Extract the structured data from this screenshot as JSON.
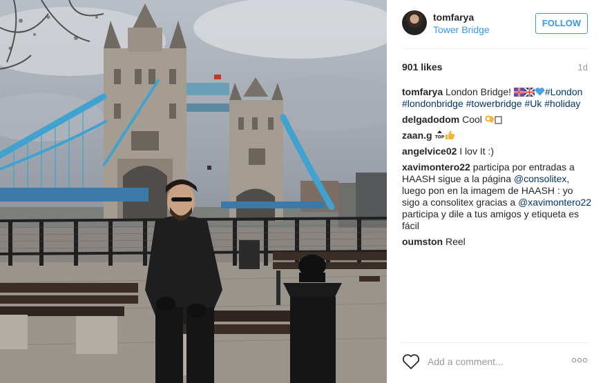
{
  "post": {
    "username": "tomfarya",
    "location": "Tower Bridge",
    "follow_label": "FOLLOW",
    "likes": "901 likes",
    "age": "1d"
  },
  "comments": [
    {
      "author": "tomfarya",
      "text": "London Bridge!",
      "tags": [
        "#London",
        "#londonbridge",
        "#towerbridge",
        "#Uk",
        "#holiday"
      ]
    },
    {
      "author": "delgadodom",
      "text": "Cool"
    },
    {
      "author": "zaan.g",
      "text": ""
    },
    {
      "author": "angelvice02",
      "text": "I lov It :)"
    },
    {
      "author": "xavimontero22",
      "text_1": "participa por entradas a HAASH sigue a la página",
      "mention_1": "@consolitex",
      "text_2": ", luego pon en la imagem de HAASH : yo sigo a consolitex gracias a",
      "mention_2": "@xavimontero22",
      "text_3": "participa y dile a tus amigos y etiqueta es fácil"
    },
    {
      "author": "oumston",
      "text": "Reel"
    }
  ],
  "composer": {
    "placeholder": "Add a comment..."
  },
  "icons": [
    "heart-icon",
    "more-options-icon",
    "flag-emoji",
    "heart-emoji",
    "ok-hand-emoji",
    "top-emoji",
    "thumbs-up-emoji"
  ],
  "colors": {
    "link": "#3897f0",
    "hashtag": "#003569",
    "bridge_blue": "#3fa2cf"
  }
}
